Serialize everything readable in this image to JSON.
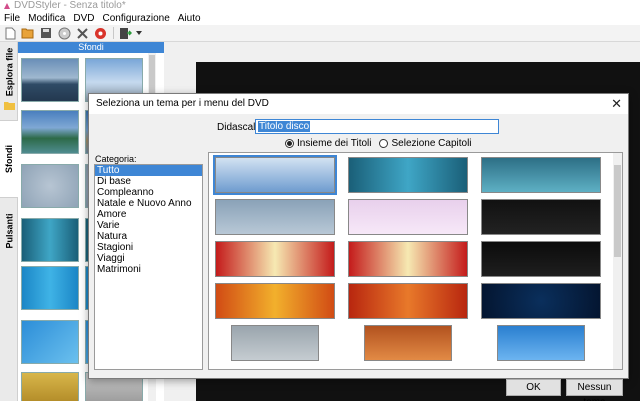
{
  "window": {
    "title": "DVDStyler - Senza titolo*"
  },
  "menu": [
    "File",
    "Modifica",
    "DVD",
    "Configurazione",
    "Aiuto"
  ],
  "toolbar_icons": [
    "new-icon",
    "open-icon",
    "save-icon",
    "burn-icon",
    "settings-icon",
    "record-icon",
    "export-icon",
    "dropdown-arrow-icon"
  ],
  "side_tabs": [
    "Esplora file",
    "Sfondi",
    "Pulsanti"
  ],
  "panel": {
    "header": "Sfondi"
  },
  "dialog": {
    "title": "Seleziona un tema per i menu del DVD",
    "caption_label": "Didascalia:",
    "caption_value": "Titolo disco",
    "radio_titles": "Insieme dei Titoli",
    "radio_chapters": "Selezione Capitoli",
    "category_label": "Categoria:",
    "categories": [
      "Tutto",
      "Di base",
      "Compleanno",
      "Natale e Nuovo Anno",
      "Amore",
      "Varie",
      "Natura",
      "Stagioni",
      "Viaggi",
      "Matrimoni"
    ],
    "selected_category": "Tutto",
    "ok_label": "OK",
    "none_label": "Nessun tema",
    "close_glyph": "✕"
  },
  "colors": {
    "selection": "#3e86d5",
    "canvas": "#111111"
  }
}
